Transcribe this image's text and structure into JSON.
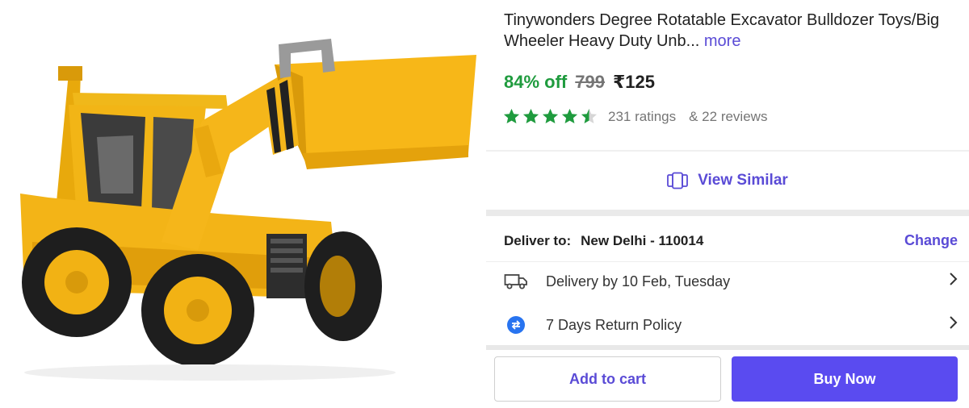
{
  "product": {
    "title": "Tinywonders Degree Rotatable Excavator Bulldozer Toys/Big Wheeler Heavy Duty Unb...",
    "more_label": "more",
    "image_alt": "Yellow JCX toy excavator bulldozer"
  },
  "pricing": {
    "discount": "84% off",
    "mrp": "799",
    "price": "₹125"
  },
  "rating": {
    "stars": 4.5,
    "ratings_text": "231 ratings",
    "reviews_text": "& 22 reviews"
  },
  "view_similar": {
    "label": "View Similar"
  },
  "delivery": {
    "deliver_to_label": "Deliver to:",
    "location": "New Delhi - 110014",
    "change_label": "Change",
    "delivery_date": "Delivery by 10 Feb, Tuesday",
    "return_policy": "7 Days Return Policy"
  },
  "actions": {
    "add_to_cart": "Add to cart",
    "buy_now": "Buy Now"
  },
  "colors": {
    "accent": "#5a4bd6",
    "buy_button": "#5a4bf0",
    "discount_green": "#1f9b3e",
    "star_green": "#1f9b3e"
  },
  "icons": [
    "view-similar-icon",
    "truck-icon",
    "return-policy-icon",
    "chevron-right-icon",
    "star-icon"
  ]
}
